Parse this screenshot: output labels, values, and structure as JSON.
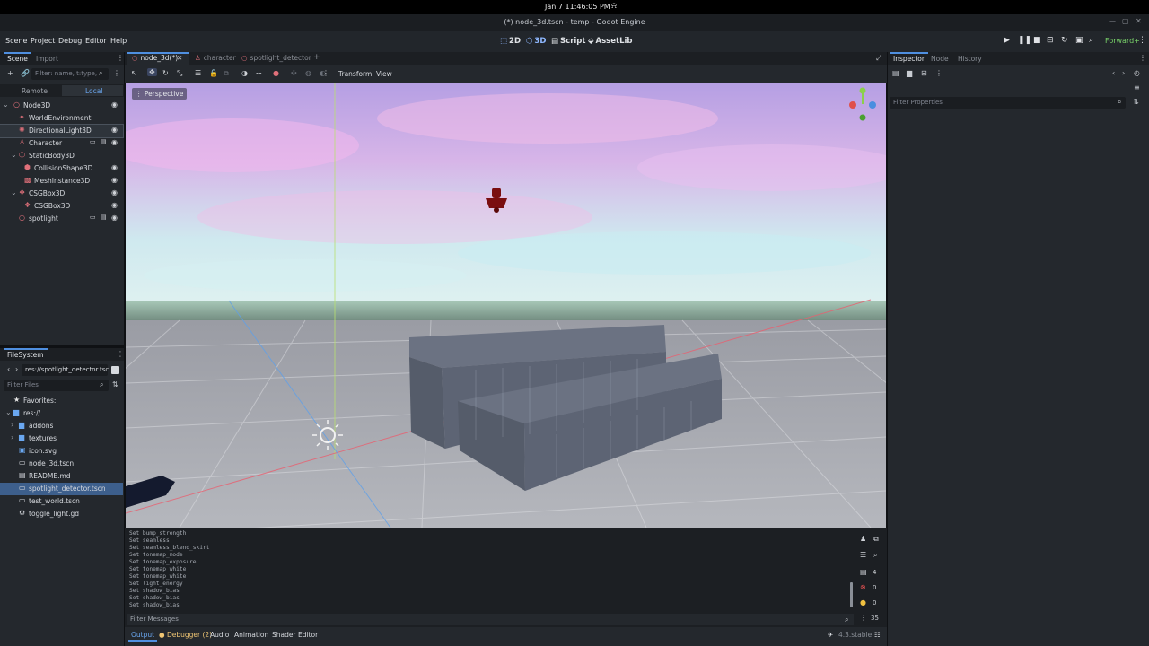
{
  "os": {
    "clock": "Jan 7  11:46:05 PM"
  },
  "window": {
    "title": "(*) node_3d.tscn - temp - Godot Engine"
  },
  "menu": [
    "Scene",
    "Project",
    "Debug",
    "Editor",
    "Help"
  ],
  "workspaces": [
    {
      "label": "2D",
      "icon": "2d-icon"
    },
    {
      "label": "3D",
      "icon": "3d-icon"
    },
    {
      "label": "Script",
      "icon": "script-icon"
    },
    {
      "label": "AssetLib",
      "icon": "assetlib-icon"
    }
  ],
  "renderer": "Forward+",
  "scene_dock": {
    "tabs": [
      "Scene",
      "Import"
    ],
    "filter_placeholder": "Filter: name, t:type,",
    "subtabs": [
      "Remote",
      "Local"
    ],
    "nodes": [
      {
        "label": "Node3D",
        "icon": "node3d-icon",
        "color": "#e0707a"
      },
      {
        "label": "WorldEnvironment",
        "icon": "world-environment-icon",
        "color": "#e0707a"
      },
      {
        "label": "DirectionalLight3D",
        "icon": "directional-light-icon",
        "color": "#e0707a"
      },
      {
        "label": "Character",
        "icon": "character-icon",
        "color": "#e0707a"
      },
      {
        "label": "StaticBody3D",
        "icon": "static-body-icon",
        "color": "#e0707a"
      },
      {
        "label": "CollisionShape3D",
        "icon": "collision-shape-icon",
        "color": "#e0707a"
      },
      {
        "label": "MeshInstance3D",
        "icon": "mesh-instance-icon",
        "color": "#e0707a"
      },
      {
        "label": "CSGBox3D",
        "icon": "csg-box-icon",
        "color": "#e0707a"
      },
      {
        "label": "CSGBox3D",
        "icon": "csg-box-icon",
        "color": "#e0707a"
      },
      {
        "label": "spotlight",
        "icon": "spotlight-icon",
        "color": "#e0707a"
      }
    ]
  },
  "filesystem": {
    "tab": "FileSystem",
    "path": "res://spotlight_detector.tsc",
    "filter_placeholder": "Filter Files",
    "items": [
      {
        "label": "Favorites:",
        "icon": "star-icon"
      },
      {
        "label": "res://",
        "icon": "folder-icon"
      },
      {
        "label": "addons",
        "icon": "folder-icon"
      },
      {
        "label": "textures",
        "icon": "folder-icon"
      },
      {
        "label": "icon.svg",
        "icon": "image-icon"
      },
      {
        "label": "node_3d.tscn",
        "icon": "scene-file-icon"
      },
      {
        "label": "README.md",
        "icon": "text-file-icon"
      },
      {
        "label": "spotlight_detector.tscn",
        "icon": "scene-file-icon"
      },
      {
        "label": "test_world.tscn",
        "icon": "scene-file-icon"
      },
      {
        "label": "toggle_light.gd",
        "icon": "script-file-icon"
      }
    ]
  },
  "scene_tabs": [
    "node_3d(*)",
    "character",
    "spotlight_detector"
  ],
  "toolbar": {
    "transform": "Transform",
    "view": "View"
  },
  "viewport": {
    "mode": "Perspective"
  },
  "inspector": {
    "tabs": [
      "Inspector",
      "Node",
      "History"
    ],
    "filter_placeholder": "Filter Properties"
  },
  "output": {
    "lines": [
      "Set bump_strength",
      "Set seamless",
      "Set seamless_blend_skirt",
      "Set tonemap_mode",
      "Set tonemap_exposure",
      "Set tonemap_white",
      "Set tonemap_white",
      "Set light_energy",
      "Set shadow_bias",
      "Set shadow_bias",
      "Set shadow_bias"
    ],
    "filter_placeholder": "Filter Messages",
    "counts": {
      "messages": "4",
      "errors": "0",
      "warnings": "0",
      "total": "35"
    }
  },
  "bottom_tabs": [
    "Output",
    "Debugger (2)",
    "Audio",
    "Animation",
    "Shader Editor"
  ],
  "version": "4.3.stable"
}
